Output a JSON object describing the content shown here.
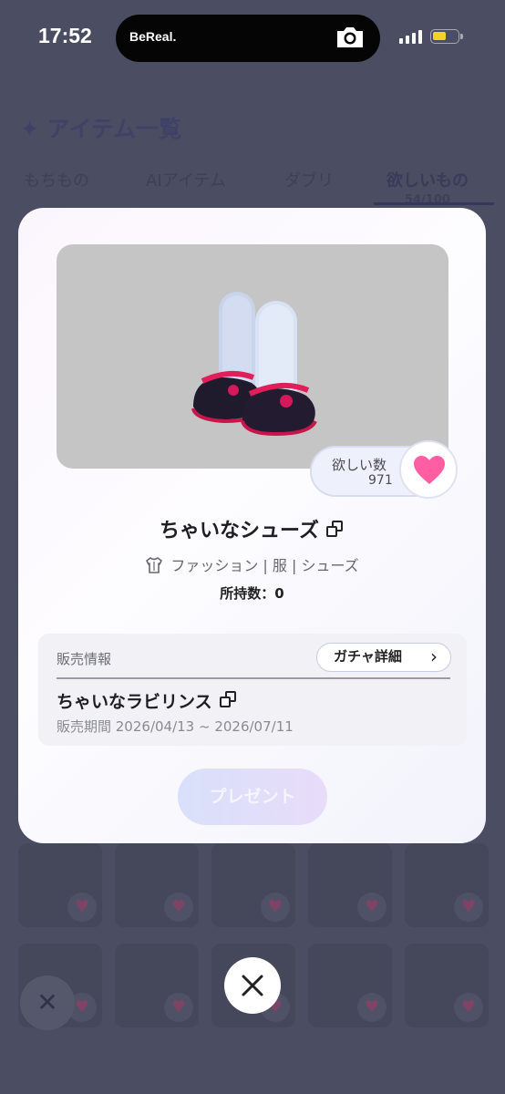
{
  "status_bar": {
    "time": "17:52",
    "island_brand": "BeReal."
  },
  "background": {
    "title": "✦ アイテム一覧",
    "tabs": [
      {
        "label": "もちもの"
      },
      {
        "label": "AIアイテム"
      },
      {
        "label": "ダブリ"
      },
      {
        "label": "欲しいもの",
        "sub": "54/100",
        "active": true
      }
    ]
  },
  "item": {
    "name": "ちゃいなシューズ",
    "category": "ファッション | 服 | シューズ",
    "owned": "所持数：0",
    "want_label": "欲しい数",
    "want_count": "971"
  },
  "sale": {
    "heading": "販売情報",
    "gacha_button": "ガチャ詳細",
    "gacha_name": "ちゃいなラビリンス",
    "period": "販売期間 2026/04/13 ~ 2026/07/11"
  },
  "actions": {
    "present": "プレゼント"
  },
  "colors": {
    "heart": "#ff5fa2",
    "accent": "#35375e",
    "backdrop": "#4b4d62"
  }
}
